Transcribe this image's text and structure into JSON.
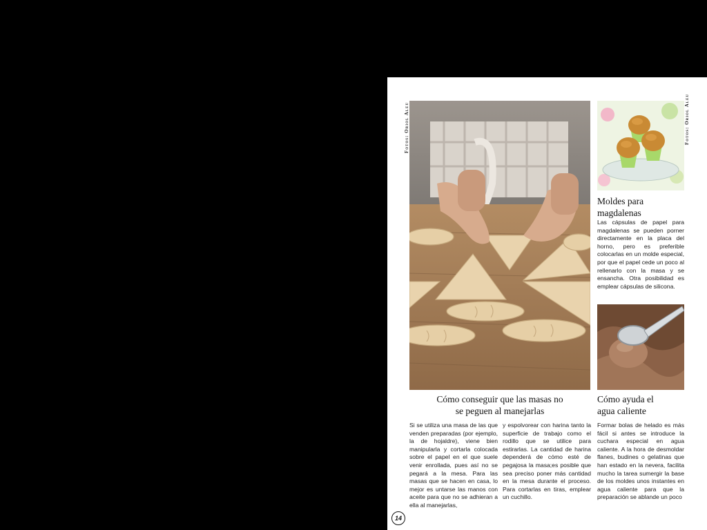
{
  "credits": {
    "left": "Fotos: Oriol Aleu",
    "right": "Fotos: Oriol Aleu"
  },
  "main": {
    "title_line1": "Cómo conseguir que las masas no",
    "title_line2": "se peguen al manejarlas",
    "col1": "Si se utiliza una masa de las que venden preparadas (por ejemplo, la de hojaldre), viene bien manipularla y cortarla colocada sobre el papel en el que suele venir enrollada, pues así no se pegará a la mesa. Para las masas que se hacen en casa, lo mejor es untarse las manos con aceite para que no se adhieran a ella al manejarlas,",
    "col2": "y espolvorear con harina tanto la superficie de trabajo como el rodillo que se utilice para estirarlas. La cantidad de harina dependerá de cómo esté de pegajosa la masa;es posible que sea preciso poner más cantidad en la mesa durante el proceso. Para cortarlas en tiras, emplear un cuchillo."
  },
  "moldes": {
    "title_line1": "Moldes para",
    "title_line2": "magdalenas",
    "text": "Las cápsulas de papel para magdalenas se pueden porner directamente en la placa del horno, pero es preferible colocarlas en un molde especial, por que el papel cede un poco al rellenarlo con la masa y se ensancha. Otra posibilidad es emplear cápsulas de silicona."
  },
  "agua": {
    "title_line1": "Cómo ayuda el",
    "title_line2": "agua caliente",
    "text": "Formar bolas de helado es más fácil si antes se introduce la cuchara especial en agua caliente. A la hora de desmoldar flanes, budines o gelatinas que han estado en la nevera, facilita mucho la tarea sumergir la base de los moldes unos instantes en agua caliente para que la preparación se ablande un poco"
  },
  "page_number": "14"
}
